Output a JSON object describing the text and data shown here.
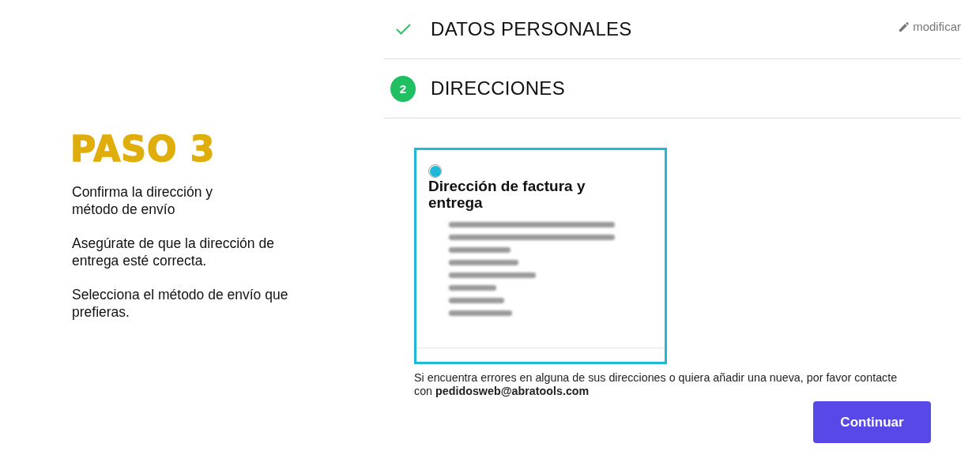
{
  "intro": {
    "heading": "PASO 3",
    "paragraphs": [
      "Confirma la dirección y\nmétodo de envío",
      "Asegúrate de que la dirección de\nentrega esté correcta.",
      "Selecciona el método de envío que\nprefieras."
    ]
  },
  "steps": [
    {
      "kind": "done",
      "title": "DATOS PERSONALES",
      "action": "modificar"
    },
    {
      "kind": "current",
      "number": "2",
      "title": "DIRECCIONES"
    }
  ],
  "address_card": {
    "selected": true,
    "title": "Dirección de factura y entrega",
    "address": {
      "kind": "blurred"
    }
  },
  "note": "Si encuentra errores en alguna de sus direcciones o quiera añadir una nueva, por favor contacte con **pedidosweb@abratools.com**",
  "button": "Continuar"
}
